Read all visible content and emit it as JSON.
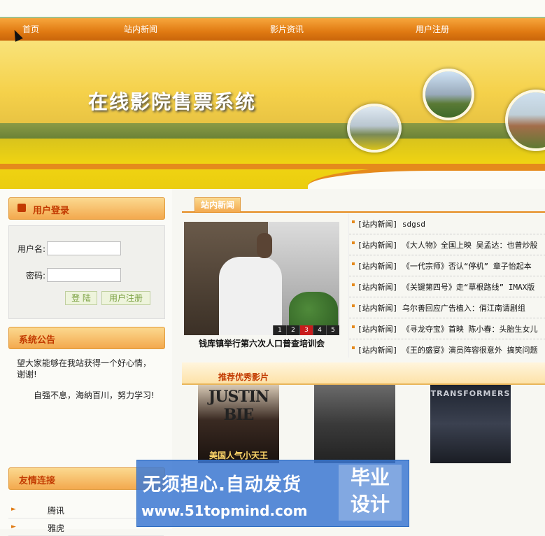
{
  "nav": {
    "items": [
      "首页",
      "站内新闻",
      "影片资讯",
      "用户注册"
    ]
  },
  "banner": {
    "title": "在线影院售票系统"
  },
  "login": {
    "heading": "用户登录",
    "username_label": "用户名:",
    "password_label": "密码:",
    "login_button": "登 陆",
    "register_button": "用户注册"
  },
  "announcement": {
    "heading": "系统公告",
    "lines": [
      "望大家能够在我站获得一个好心情，谢谢!",
      "自强不息，海纳百川，努力学习!"
    ]
  },
  "friend_links": {
    "heading": "友情连接",
    "items": [
      "腾讯",
      "雅虎"
    ]
  },
  "news": {
    "tab": "站内新闻",
    "slider_caption": "钱库镇举行第六次人口普查培训会",
    "pager": [
      "1",
      "2",
      "3",
      "4",
      "5"
    ],
    "active_page": "3",
    "items": [
      "[站内新闻] sdgsd",
      "[站内新闻] 《大人物》全国上映 吴孟达：也曾炒股",
      "[站内新闻] 《一代宗师》否认“停机” 章子怡起本",
      "[站内新闻] 《关键第四号》走“草根路线” IMAX版",
      "[站内新闻] 乌尔善回应广告植入：俏江南请剧组",
      "[站内新闻] 《寻龙夺宝》首映 陈小春：头胎生女儿",
      "[站内新闻] 《王的盛宴》演员阵容很意外 搞笑问题"
    ]
  },
  "recommended": {
    "heading": "推荐优秀影片",
    "posters": [
      {
        "title": "JUSTIN BIE",
        "subtitle": "美国人气小天王"
      },
      {
        "title": "",
        "subtitle": ""
      },
      {
        "title": "TRANSFORMERS",
        "subtitle": ""
      }
    ]
  },
  "watermark": {
    "line1": "无须担心.自动发货",
    "line2": "www.51topmind.com",
    "badge1": "毕业",
    "badge2": "设计"
  },
  "colors": {
    "nav_orange": "#e07a12",
    "heading_red": "#c23a00",
    "accent": "#e58a1c",
    "active_page": "#c81c1c"
  }
}
